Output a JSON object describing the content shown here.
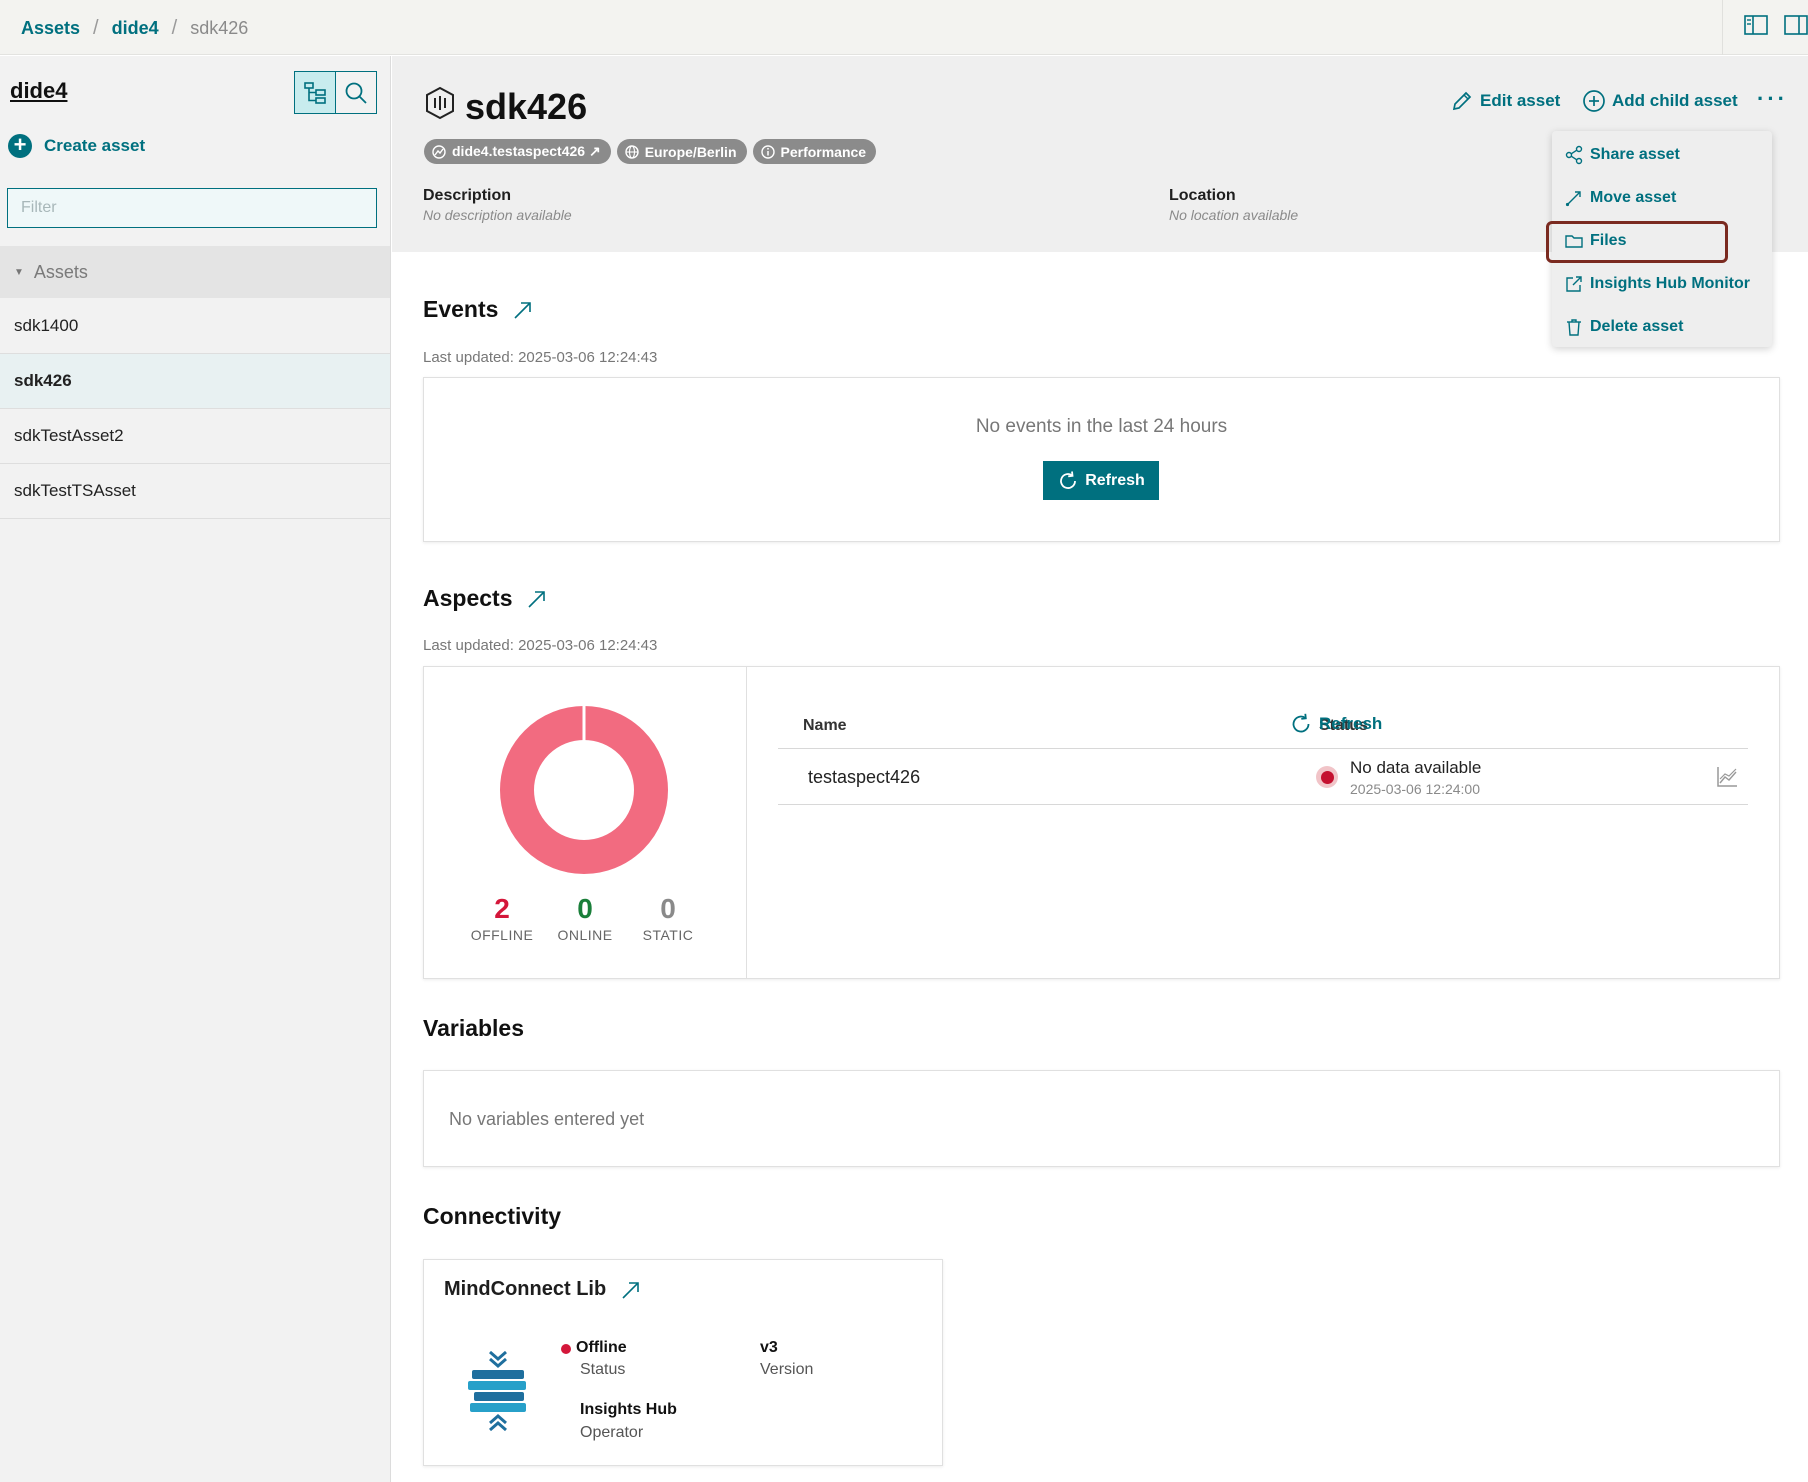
{
  "breadcrumb": {
    "root": "Assets",
    "parent": "dide4",
    "current": "sdk426"
  },
  "icons": {
    "layout_left": "sidebar-left-panel-icon",
    "layout_right": "sidebar-right-panel-icon",
    "tree_view": "tree-view-icon",
    "search": "search-icon"
  },
  "sidebar": {
    "title": "dide4",
    "create_label": "Create asset",
    "filter_placeholder": "Filter",
    "tree_header": "Assets",
    "items": [
      {
        "label": "sdk1400",
        "selected": false
      },
      {
        "label": "sdk426",
        "selected": true
      },
      {
        "label": "sdkTestAsset2",
        "selected": false
      },
      {
        "label": "sdkTestTSAsset",
        "selected": false
      }
    ]
  },
  "asset": {
    "title": "sdk426",
    "chips": [
      {
        "label": "dide4.testaspect426 ↗",
        "icon": "asset-type-icon"
      },
      {
        "label": "Europe/Berlin",
        "icon": "globe-icon"
      },
      {
        "label": "Performance",
        "icon": "info-icon"
      }
    ],
    "description_label": "Description",
    "description_value": "No description available",
    "location_label": "Location",
    "location_value": "No location available",
    "edit_label": "Edit asset",
    "add_child_label": "Add child asset",
    "more_label": "···"
  },
  "menu": {
    "items": [
      {
        "label": "Share asset",
        "icon": "share-icon"
      },
      {
        "label": "Move asset",
        "icon": "move-icon"
      },
      {
        "label": "Files",
        "icon": "folder-icon"
      },
      {
        "label": "Insights Hub Monitor",
        "icon": "external-link-icon"
      },
      {
        "label": "Delete asset",
        "icon": "trash-icon"
      }
    ]
  },
  "events": {
    "title": "Events",
    "updated": "Last updated: 2025-03-06 12:24:43",
    "empty": "No events in the last 24 hours",
    "refresh_label": "Refresh"
  },
  "aspects": {
    "title": "Aspects",
    "updated": "Last updated: 2025-03-06 12:24:43",
    "stats": {
      "offline": {
        "value": "2",
        "label": "OFFLINE"
      },
      "online": {
        "value": "0",
        "label": "ONLINE"
      },
      "static": {
        "value": "0",
        "label": "STATIC"
      }
    },
    "donut_color": "#f26b80",
    "table": {
      "col_name": "Name",
      "col_status": "Status",
      "refresh_label": "Refresh",
      "rows": [
        {
          "name": "testaspect426",
          "status": "No data available",
          "time": "2025-03-06 12:24:00"
        }
      ]
    }
  },
  "variables": {
    "title": "Variables",
    "empty": "No variables entered yet"
  },
  "connectivity": {
    "title": "Connectivity",
    "card_title": "MindConnect Lib",
    "status_value": "Offline",
    "status_label": "Status",
    "version_value": "v3",
    "version_label": "Version",
    "operator_value": "Insights Hub",
    "operator_label": "Operator"
  },
  "colors": {
    "accent": "#00707f",
    "offline": "#d4173a",
    "online": "#1a7f3a",
    "static": "#8a8a8a",
    "highlight_border": "#7a2a20"
  }
}
